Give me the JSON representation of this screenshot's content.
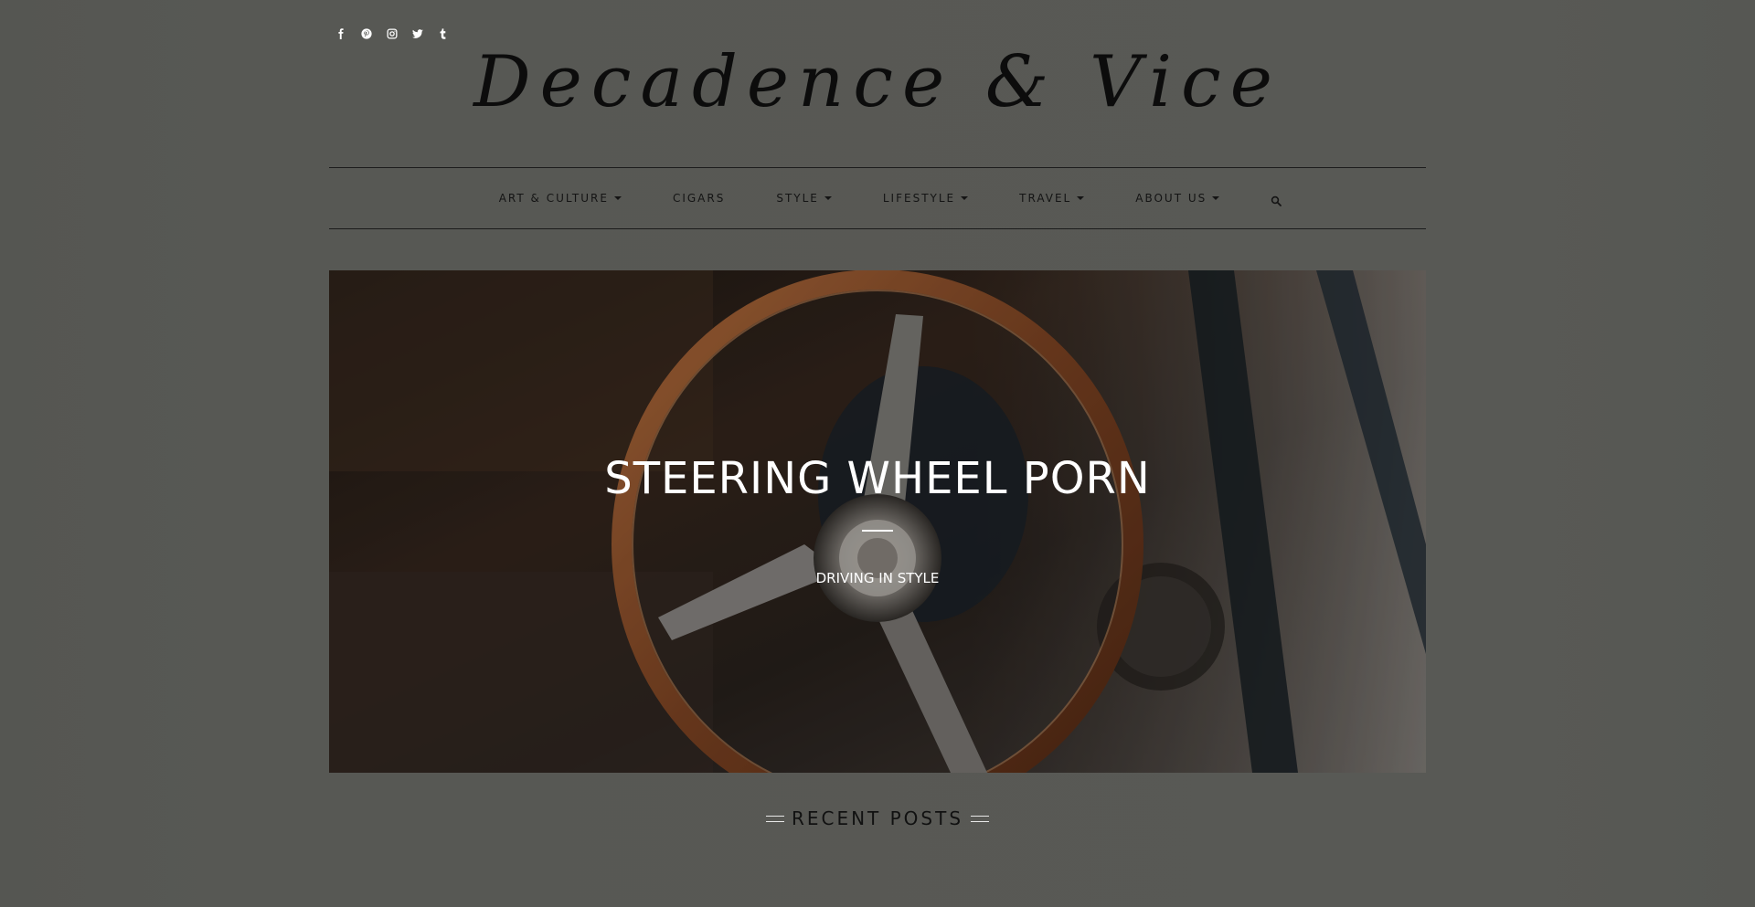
{
  "site": {
    "logo_text": "Decadence & Vice"
  },
  "social": {
    "icons": [
      "facebook-icon",
      "pinterest-icon",
      "instagram-icon",
      "twitter-icon",
      "tumblr-icon"
    ]
  },
  "nav": {
    "items": [
      {
        "label": "ART & CULTURE",
        "has_dropdown": true
      },
      {
        "label": "CIGARS",
        "has_dropdown": false
      },
      {
        "label": "STYLE",
        "has_dropdown": true
      },
      {
        "label": "LIFESTYLE",
        "has_dropdown": true
      },
      {
        "label": "TRAVEL",
        "has_dropdown": true
      },
      {
        "label": "ABOUT US",
        "has_dropdown": true
      }
    ],
    "search_icon": "search-icon"
  },
  "hero": {
    "title": "STEERING WHEEL PORN",
    "subtitle": "DRIVING IN STYLE"
  },
  "recent_posts": {
    "heading": "RECENT POSTS"
  },
  "colors": {
    "background": "#575854",
    "text_dark": "#141414",
    "hero_text": "#ffffff"
  }
}
